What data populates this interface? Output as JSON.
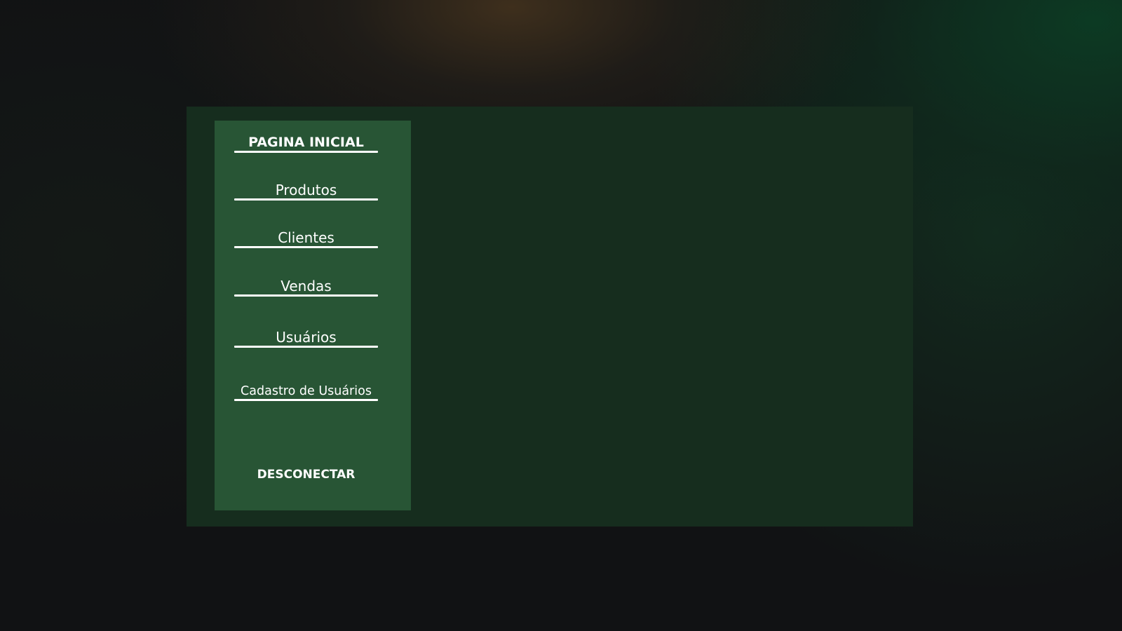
{
  "sidebar": {
    "items": [
      {
        "label": "PAGINA INICIAL"
      },
      {
        "label": "Produtos"
      },
      {
        "label": "Clientes"
      },
      {
        "label": "Vendas"
      },
      {
        "label": "Usuários"
      },
      {
        "label": "Cadastro de Usuários"
      }
    ],
    "disconnect_label": "DESCONECTAR"
  },
  "colors": {
    "background": "#111214",
    "panel": "#162d1e",
    "sidebar": "#285535",
    "text": "#ffffff"
  }
}
